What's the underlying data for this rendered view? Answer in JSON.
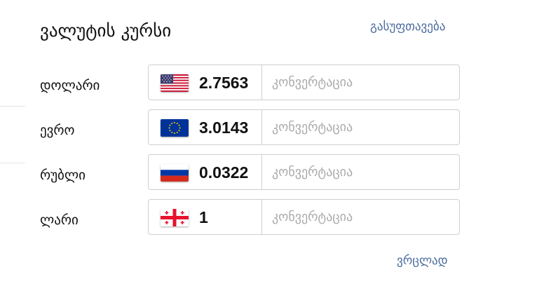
{
  "title": "ვალუტის კურსი",
  "clear_label": "გასუფთავება",
  "more_label": "ვრცლად",
  "convert_placeholder": "კონვერტაცია",
  "currencies": [
    {
      "name": "დოლარი",
      "rate": "2.7563",
      "flag": "us-flag-icon"
    },
    {
      "name": "ევრო",
      "rate": "3.0143",
      "flag": "eu-flag-icon"
    },
    {
      "name": "რუბლი",
      "rate": "0.0322",
      "flag": "ru-flag-icon"
    },
    {
      "name": "ლარი",
      "rate": "1",
      "flag": "ge-flag-icon"
    }
  ],
  "colors": {
    "link": "#4a6a9d",
    "border": "#cfcfcf",
    "placeholder": "#aaaaaa"
  }
}
